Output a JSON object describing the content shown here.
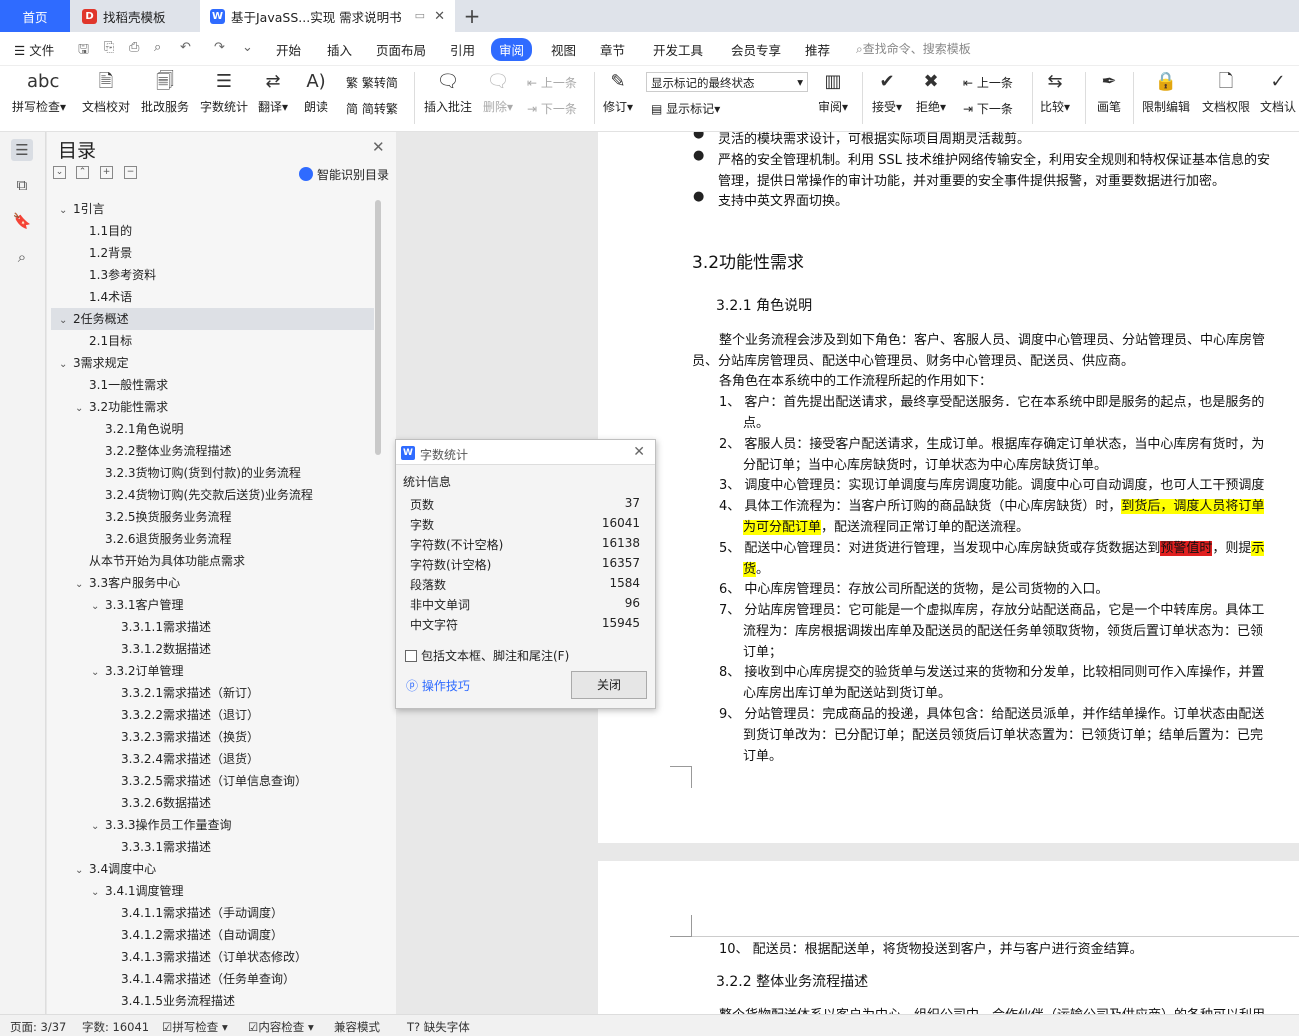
{
  "tabs": {
    "home": "首页",
    "template": "找稻壳模板",
    "doc": "基于JavaSS...实现 需求说明书"
  },
  "menu": {
    "file": "文件",
    "items": [
      "开始",
      "插入",
      "页面布局",
      "引用",
      "审阅",
      "视图",
      "章节",
      "开发工具",
      "会员专享",
      "推荐"
    ],
    "search": "查找命令、搜索模板"
  },
  "ribbon": {
    "spell": "拼写检查",
    "proofread": "文档校对",
    "batch": "批改服务",
    "wordcount": "字数统计",
    "translate": "翻译",
    "read": "朗读",
    "to_simplified": "繁转简",
    "to_traditional": "简转繁",
    "insert_comment": "插入批注",
    "delete": "删除",
    "prev_c": "上一条",
    "next_c": "下一条",
    "revise": "修订",
    "show_select": "显示标记的最终状态",
    "show_marks": "显示标记",
    "review_pane": "审阅",
    "accept": "接受",
    "reject": "拒绝",
    "prev": "上一条",
    "next": "下一条",
    "compare": "比较",
    "pen": "画笔",
    "restrict": "限制编辑",
    "perm": "文档权限",
    "cert": "文档认"
  },
  "toc": {
    "title": "目录",
    "smart": "智能识别目录",
    "items": [
      "1引言",
      "1.1目的",
      "1.2背景",
      "1.3参考资料",
      "1.4术语",
      "2任务概述",
      "2.1目标",
      "3需求规定",
      "3.1一般性需求",
      "3.2功能性需求",
      "3.2.1角色说明",
      "3.2.2整体业务流程描述",
      "3.2.3货物订购(货到付款)的业务流程",
      "3.2.4货物订购(先交款后送货)业务流程",
      "3.2.5换货服务业务流程",
      "3.2.6退货服务业务流程",
      "从本节开始为具体功能点需求",
      "3.3客户服务中心",
      "3.3.1客户管理",
      "3.3.1.1需求描述",
      "3.3.1.2数据描述",
      "3.3.2订单管理",
      "3.3.2.1需求描述（新订）",
      "3.3.2.2需求描述（退订）",
      "3.3.2.3需求描述（换货）",
      "3.3.2.4需求描述（退货）",
      "3.3.2.5需求描述（订单信息查询）",
      "3.3.2.6数据描述",
      "3.3.3操作员工作量查询",
      "3.3.3.1需求描述",
      "3.4调度中心",
      "3.4.1调度管理",
      "3.4.1.1需求描述（手动调度）",
      "3.4.1.2需求描述（自动调度）",
      "3.4.1.3需求描述（订单状态修改）",
      "3.4.1.4需求描述（任务单查询）",
      "3.4.1.5业务流程描述"
    ]
  },
  "doc": {
    "b0": "灵活的模块需求设计，可根据实际项目周期灵活裁剪。",
    "b1a": "严格的安全管理机制。利用 SSL 技术维护网络传输安全，利用安全规则和特权保证基本信息的安",
    "b1b": "管理，提供日常操作的审计功能，并对重要的安全事件提供报警，对重要数据进行加密。",
    "b2": "支持中英文界面切换。",
    "h32": "3.2功能性需求",
    "h321": "3.2.1    角色说明",
    "p1a": "整个业务流程会涉及到如下角色：客户、客服人员、调度中心管理员、分站管理员、中心库房管",
    "p1b": "员、分站库房管理员、配送中心管理员、财务中心管理员、配送员、供应商。",
    "p2": "各角色在本系统中的工作流程所起的作用如下：",
    "l1a": "1、 客户：首先提出配送请求，最终享受配送服务．它在本系统中即是服务的起点，也是服务的",
    "l1b": "点。",
    "l2a": "2、 客服人员：接受客户配送请求，生成订单。根据库存确定订单状态，当中心库房有货时，为",
    "l2b": "分配订单；当中心库房缺货时，订单状态为中心库房缺货订单。",
    "l3": "3、 调度中心管理员：实现订单调度与库房调度功能。调度中心可自动调度，也可人工干预调度",
    "l4a": "4、 具体工作流程为：当客户所订购的商品缺货（中心库房缺货）时，",
    "l4hl": "到货后，调度人员将订单",
    "l4b_hl": "为可分配订单",
    "l4b": "，配送流程同正常订单的配送流程。",
    "l5a": "5、 配送中心管理员：对进货进行管理，当发现中心库房缺货或存货数据达到",
    "l5red": "预警值时",
    "l5tail": "，则提",
    "l5tailhl": "示",
    "l5b_hl": "货",
    "l5b": "。",
    "l6": "6、 中心库房管理员：存放公司所配送的货物，是公司货物的入口。",
    "l7a": "7、 分站库房管理员：它可能是一个虚拟库房，存放分站配送商品，它是一个中转库房。具体工",
    "l7b": "流程为：库房根据调拨出库单及配送员的配送任务单领取货物，领货后置订单状态为：已领",
    "l7c": "订单；",
    "l8a": "8、 接收到中心库房提交的验货单与发送过来的货物和分发单，比较相同则可作入库操作，并置",
    "l8b": "心库房出库订单为配送站到货订单。",
    "l9a": "9、 分站管理员：完成商品的投递，具体包含：给配送员派单，并作结单操作。订单状态由配送",
    "l9b": "到货订单改为：已分配订单；配送员领货后订单状态置为：已领货订单；结单后置为：已完",
    "l9c": "订单。",
    "l10": "10、      配送员：根据配送单，将货物投送到客户，并与客户进行资金结算。",
    "h322": "3.2.2    整体业务流程描述",
    "p3": "整个货物配送体系以客户为中心，组织公司中，合作伙伴（运输公司及供应商）的各种可以利用"
  },
  "dialog": {
    "title": "字数统计",
    "section": "统计信息",
    "rows": [
      [
        "页数",
        "37"
      ],
      [
        "字数",
        "16041"
      ],
      [
        "字符数(不计空格)",
        "16138"
      ],
      [
        "字符数(计空格)",
        "16357"
      ],
      [
        "段落数",
        "1584"
      ],
      [
        "非中文单词",
        "96"
      ],
      [
        "中文字符",
        "15945"
      ]
    ],
    "checkbox": "包括文本框、脚注和尾注(F)",
    "tips": "操作技巧",
    "close": "关闭"
  },
  "status": {
    "page": "页面: 3/37",
    "words": "字数: 16041",
    "spell": "拼写检查",
    "content": "内容检查",
    "compat": "兼容模式",
    "font": "缺失字体"
  }
}
